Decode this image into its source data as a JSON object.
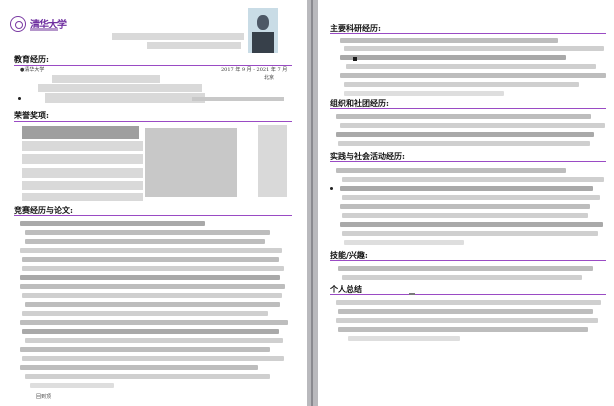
{
  "left_page": {
    "logo": {
      "name": "清华大学",
      "sub_text": "TSINGHUA UNIVERSITY"
    },
    "section_education": "教育经历:",
    "school": "●清华大学",
    "date_range": "2017 年 9 月 - 2021 年 7 月",
    "location": "北京",
    "section_awards": "荣誉奖项:",
    "section_competitions": "竞赛经历与论文:",
    "footer_label": "回到顶"
  },
  "right_page": {
    "section_research": "主要科研经历:",
    "section_org": "组织和社团经历:",
    "section_practice": "实践与社会活动经历:",
    "section_skills": "技能/兴趣:",
    "section_summary": "个人总结"
  }
}
